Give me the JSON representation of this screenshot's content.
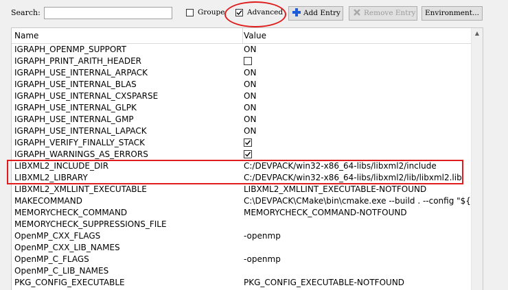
{
  "toolbar": {
    "search_label": "Search:",
    "search_value": "",
    "grouped_label": "Groupe",
    "grouped_checked": false,
    "advanced_label": "Advanced",
    "advanced_checked": true,
    "add_entry_label": "Add Entry",
    "remove_entry_label": "Remove Entry",
    "environment_label": "Environment..."
  },
  "table": {
    "columns": [
      "Name",
      "Value"
    ],
    "rows": [
      {
        "name": "IGRAPH_OPENMP_SUPPORT",
        "value": "ON"
      },
      {
        "name": "IGRAPH_PRINT_ARITH_HEADER",
        "checkbox": false
      },
      {
        "name": "IGRAPH_USE_INTERNAL_ARPACK",
        "value": "ON"
      },
      {
        "name": "IGRAPH_USE_INTERNAL_BLAS",
        "value": "ON"
      },
      {
        "name": "IGRAPH_USE_INTERNAL_CXSPARSE",
        "value": "ON"
      },
      {
        "name": "IGRAPH_USE_INTERNAL_GLPK",
        "value": "ON"
      },
      {
        "name": "IGRAPH_USE_INTERNAL_GMP",
        "value": "ON"
      },
      {
        "name": "IGRAPH_USE_INTERNAL_LAPACK",
        "value": "ON"
      },
      {
        "name": "IGRAPH_VERIFY_FINALLY_STACK",
        "checkbox": true
      },
      {
        "name": "IGRAPH_WARNINGS_AS_ERRORS",
        "checkbox": true
      },
      {
        "name": "LIBXML2_INCLUDE_DIR",
        "value": "C:/DEVPACK/win32-x86_64-libs/libxml2/include"
      },
      {
        "name": "LIBXML2_LIBRARY",
        "value": "C:/DEVPACK/win32-x86_64-libs/libxml2/lib/libxml2.lib"
      },
      {
        "name": "LIBXML2_XMLLINT_EXECUTABLE",
        "value": "LIBXML2_XMLLINT_EXECUTABLE-NOTFOUND"
      },
      {
        "name": "MAKECOMMAND",
        "value": "C:\\DEVPACK\\CMake\\bin\\cmake.exe --build . --config \"${..."
      },
      {
        "name": "MEMORYCHECK_COMMAND",
        "value": "MEMORYCHECK_COMMAND-NOTFOUND"
      },
      {
        "name": "MEMORYCHECK_SUPPRESSIONS_FILE",
        "value": ""
      },
      {
        "name": "OpenMP_CXX_FLAGS",
        "value": "-openmp"
      },
      {
        "name": "OpenMP_CXX_LIB_NAMES",
        "value": ""
      },
      {
        "name": "OpenMP_C_FLAGS",
        "value": "-openmp"
      },
      {
        "name": "OpenMP_C_LIB_NAMES",
        "value": ""
      },
      {
        "name": "PKG_CONFIG_EXECUTABLE",
        "value": "PKG_CONFIG_EXECUTABLE-NOTFOUND"
      }
    ]
  },
  "colors": {
    "annotation": "#e01b1b",
    "add_icon": "#1e5bd6"
  },
  "icons": {
    "add": "plus-icon",
    "remove": "x-icon",
    "scroll_up": "arrow-up-icon"
  }
}
